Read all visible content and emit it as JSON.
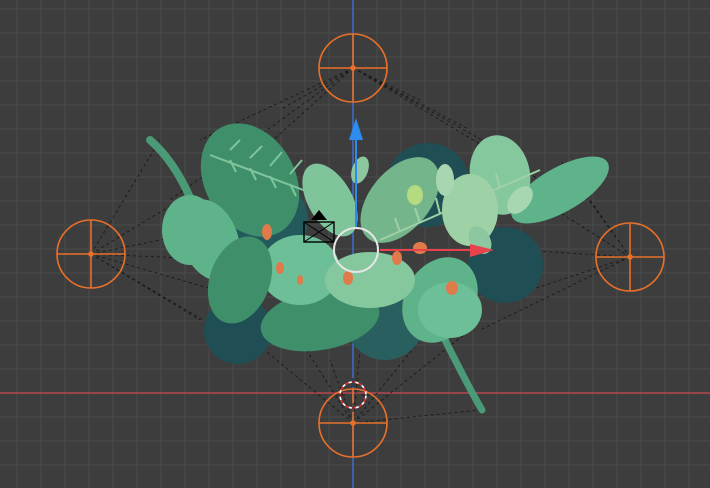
{
  "viewport": {
    "mode": "3d-viewport",
    "background": "#3d3d3d",
    "grid_color": "#4a4a4a",
    "x_axis_color": "#b5474e",
    "z_axis_color": "#3d6fcf"
  },
  "gizmo": {
    "x_arrow_color": "#e8424d",
    "z_arrow_color": "#2d8cf0",
    "center_ring_color": "#e6e6e6"
  },
  "lights": {
    "color": "#e8702a",
    "count": 4,
    "names": [
      "light-top",
      "light-left",
      "light-right",
      "light-bottom"
    ]
  },
  "scene": {
    "object": "plant-bouquet",
    "leaf_colors": [
      "#3f8f6b",
      "#5fb38a",
      "#86c89e",
      "#9fd1a7",
      "#2e6b5e",
      "#1f4e55"
    ],
    "bud_color": "#e07a4a",
    "camera_icon": "camera-icon"
  }
}
